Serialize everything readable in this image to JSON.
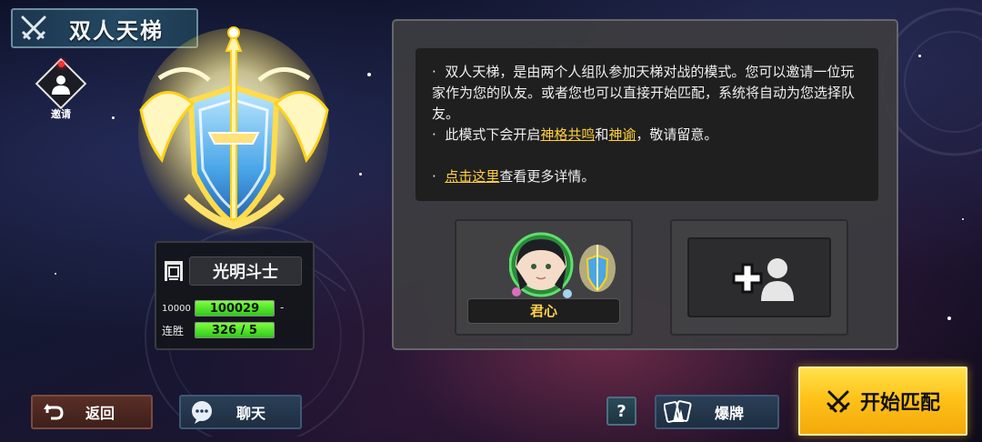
{
  "header": {
    "title": "双人天梯"
  },
  "invite": {
    "label": "邀请"
  },
  "rank": {
    "title": "光明斗士",
    "points_label": "10000",
    "points_value": "100029",
    "points_suffix": "-",
    "points_fill": 1.0,
    "streak_label": "连胜",
    "streak_value": "326 / 5",
    "streak_fill": 1.0
  },
  "info": {
    "bullet": "·",
    "p1": "双人天梯，是由两个人组队参加天梯对战的模式。您可以邀请一位玩家作为您的队友。或者您也可以直接开始匹配，系统将自动为您选择队友。",
    "p2_pre": "此模式下会开启",
    "p2_link1": "神格共鸣",
    "p2_mid": "和",
    "p2_link2": "神谕",
    "p2_post": "，敬请留意。",
    "p3_link": "点击这里",
    "p3_post": "查看更多详情。"
  },
  "slots": {
    "player_name": "君心"
  },
  "buttons": {
    "back": "返回",
    "chat": "聊天",
    "help": "?",
    "burst": "爆牌",
    "start": "开始匹配"
  },
  "colors": {
    "highlight": "#ffd03a",
    "name": "#ffd24a",
    "bar_green": "#2fc91a",
    "start_yellow": "#ffc21a"
  },
  "icons": [
    "crossed-swords-icon",
    "invite-user-icon",
    "rank-emblem-icon",
    "rank-title-icon",
    "avatar-icon",
    "add-teammate-icon",
    "back-arrow-icon",
    "chat-bubble-icon",
    "card-burst-icon",
    "start-swords-icon"
  ]
}
